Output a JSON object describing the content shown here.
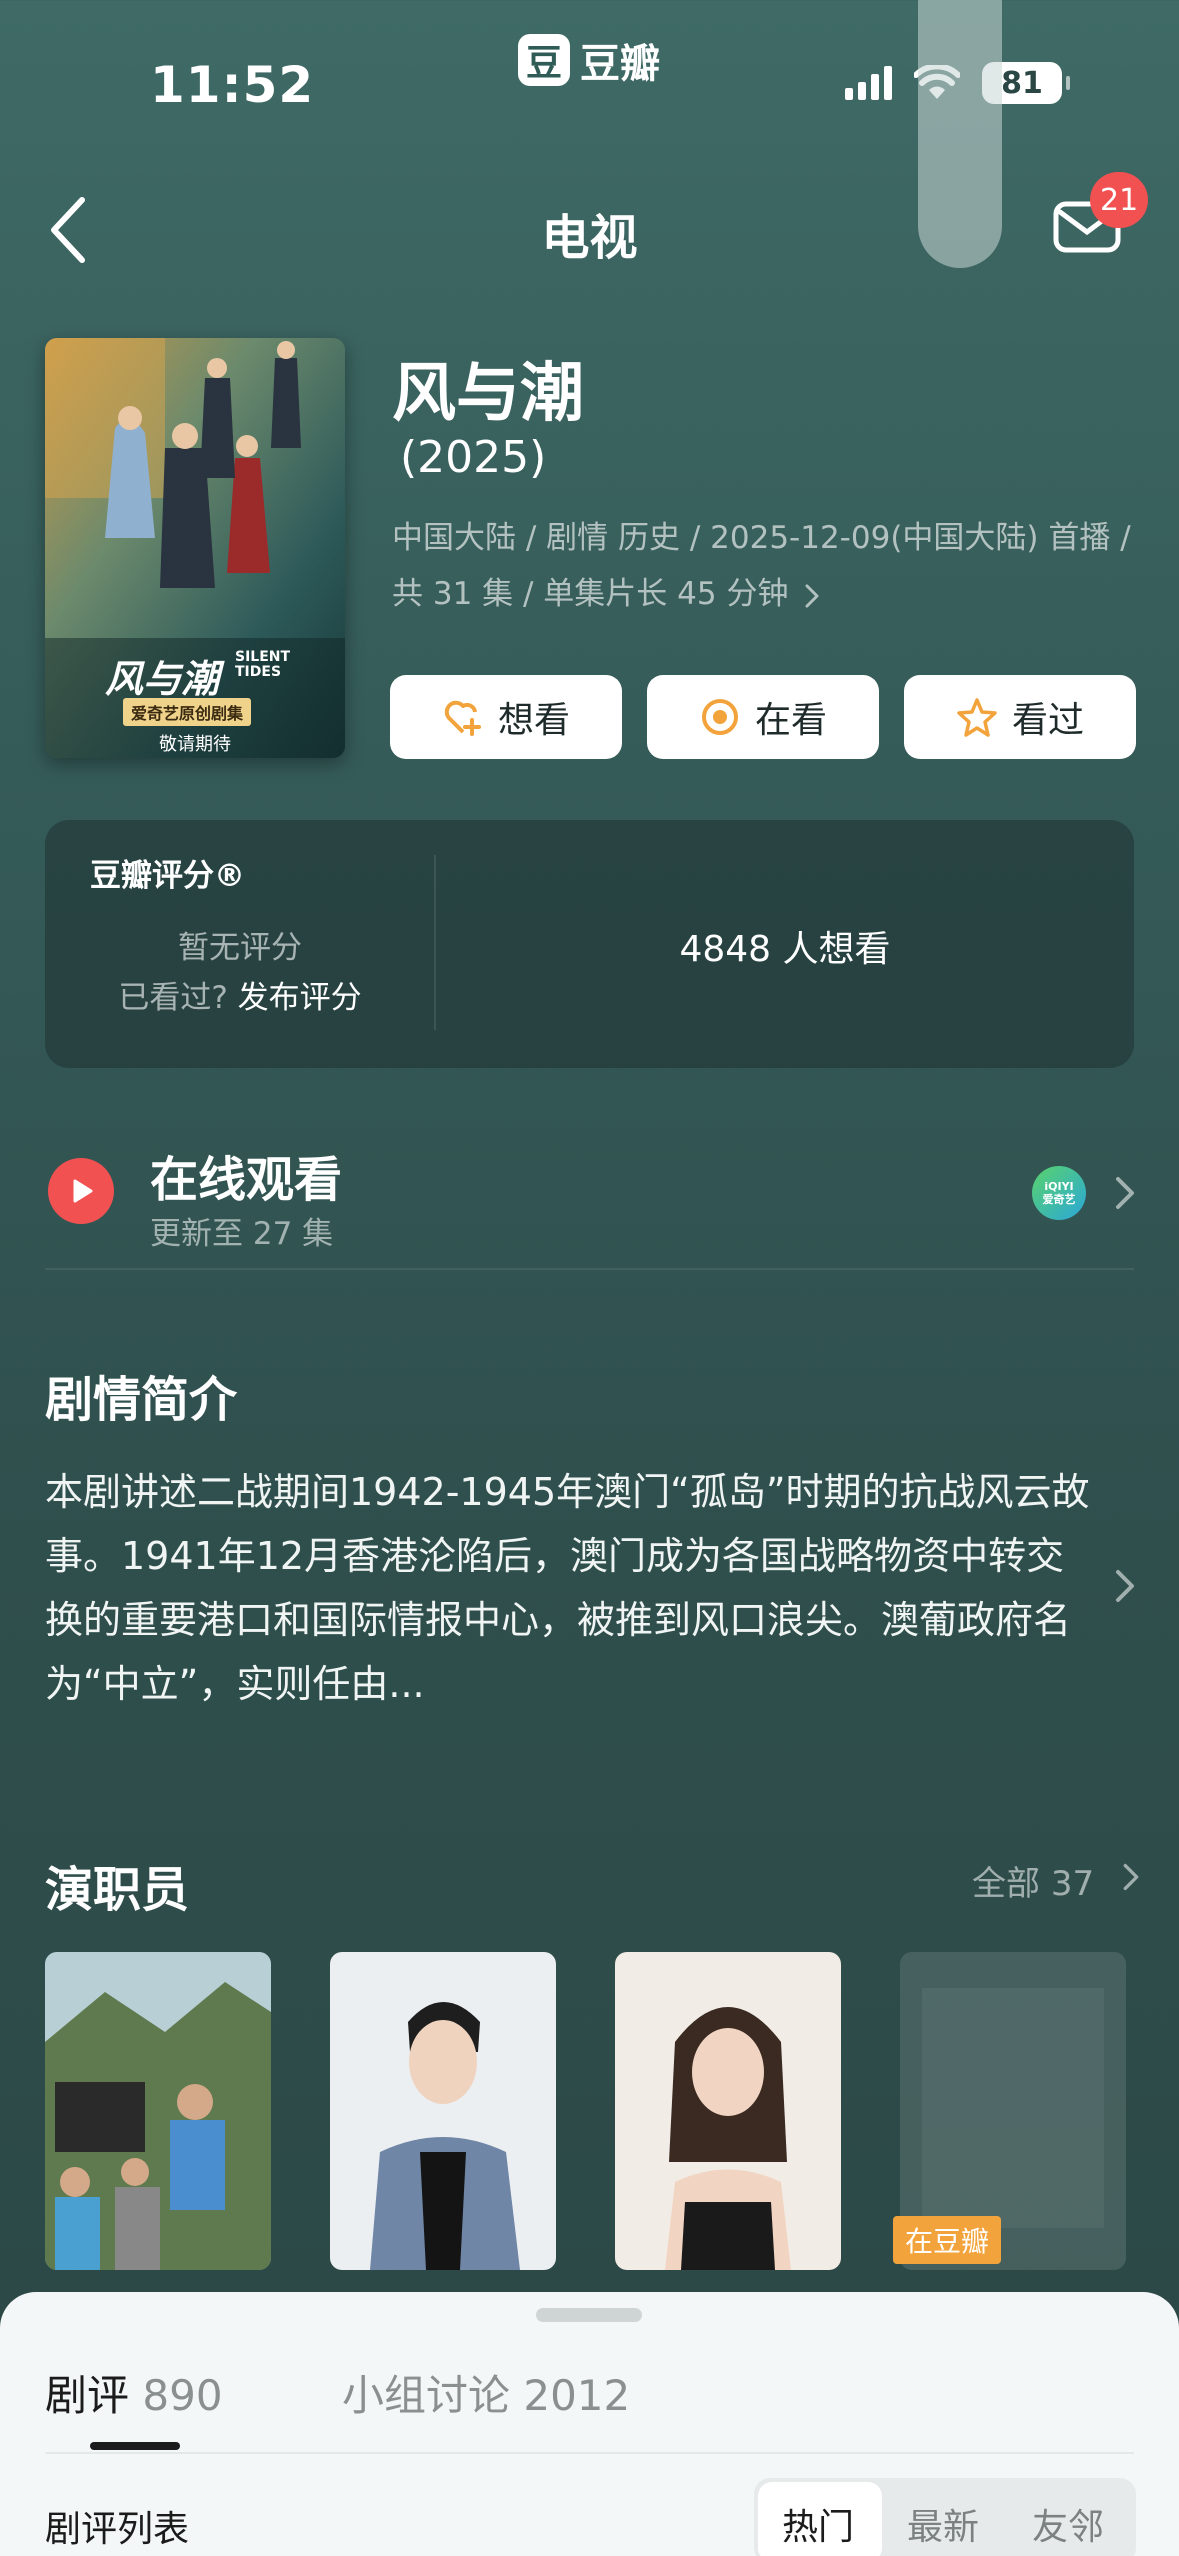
{
  "status": {
    "time": "11:52",
    "app_name": "豆瓣",
    "app_logo_char": "豆",
    "battery": "81"
  },
  "nav": {
    "title": "电视",
    "mail_badge": "21"
  },
  "show": {
    "title": "风与潮",
    "year": "(2025)",
    "meta": "中国大陆 / 剧情 历史 / 2025-12-09(中国大陆) 首播 / 共 31 集 / 单集片长 45 分钟",
    "poster": {
      "title": "风与潮",
      "subtitle_en": "SILENT TIDES",
      "tag": "爱奇艺原创剧集",
      "coming": "敬请期待"
    }
  },
  "actions": {
    "want": "想看",
    "watching": "在看",
    "watched": "看过"
  },
  "rating": {
    "title": "豆瓣评分®",
    "no_score": "暂无评分",
    "prompt": "已看过?",
    "prompt_link": "发布评分",
    "want_count": "4848 人想看"
  },
  "online": {
    "title": "在线观看",
    "subtitle": "更新至 27 集",
    "provider_text": "iQIYI",
    "provider_cn": "爱奇艺"
  },
  "synopsis": {
    "heading": "剧情简介",
    "text": "本剧讲述二战期间1942-1945年澳门“孤岛”时期的抗战风云故事。1941年12月香港沦陷后，澳门成为各国战略物资中转交换的重要港口和国际情报中心，被推到风口浪尖。澳葡政府名为“中立”，实则任由..."
  },
  "cast": {
    "heading": "演职员",
    "all_label": "全部",
    "all_count": "37",
    "douban_tag": "在豆瓣"
  },
  "sheet": {
    "tab_review": "剧评",
    "tab_review_count": "890",
    "tab_group": "小组讨论 2012",
    "list_label": "剧评列表",
    "seg_hot": "热门",
    "seg_new": "最新",
    "seg_friends": "友邻"
  },
  "colors": {
    "accent_red": "#f25151",
    "rating_star": "#f3a33b",
    "background": "#355b58"
  },
  "icons": [
    "back-icon",
    "mail-icon",
    "heart-plus-icon",
    "watching-icon",
    "star-icon",
    "play-icon",
    "chevron-right-icon"
  ]
}
